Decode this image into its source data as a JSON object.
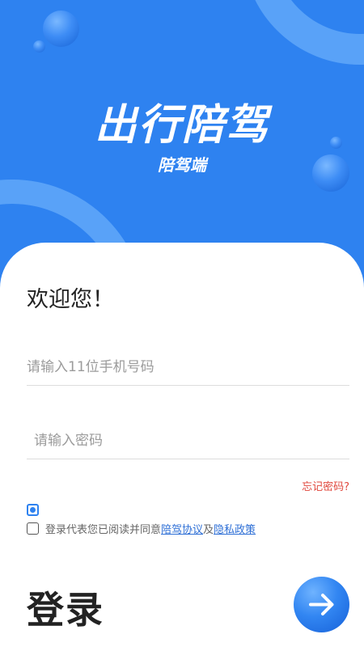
{
  "header": {
    "title": "出行陪驾",
    "subtitle": "陪驾端"
  },
  "welcome": "欢迎您！",
  "form": {
    "phone_placeholder": "请输入11位手机号码",
    "password_placeholder": "请输入密码",
    "forgot_password": "忘记密码?"
  },
  "agreement": {
    "prefix": "登录代表您已阅读并同意",
    "link1": "陪驾协议",
    "join": "及",
    "link2": "隐私政策"
  },
  "login": {
    "label": "登录",
    "button_icon": "arrow-right-icon"
  },
  "colors": {
    "primary": "#2e82f0",
    "forgot": "#e0483e",
    "link": "#2e6fd6"
  }
}
